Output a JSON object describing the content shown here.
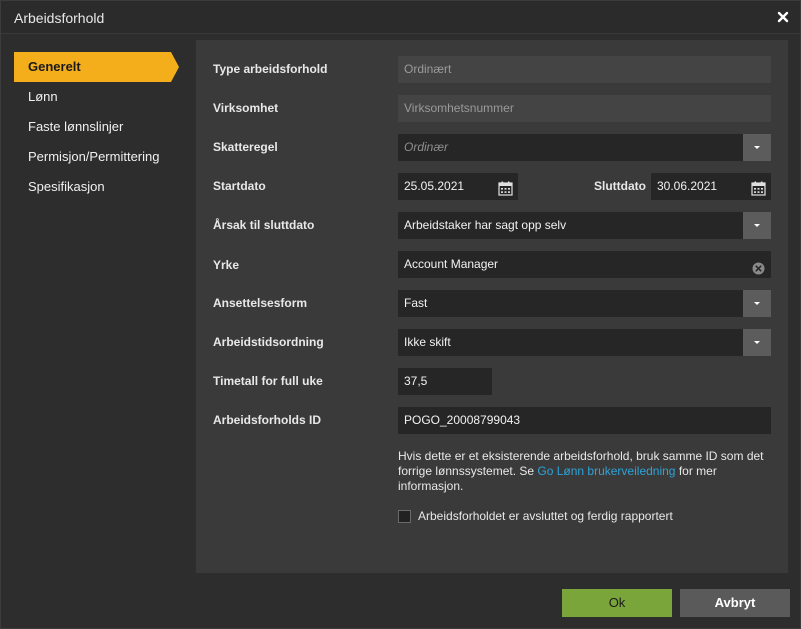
{
  "dialog": {
    "title": "Arbeidsforhold",
    "close_icon": "close-icon"
  },
  "sidebar": {
    "items": [
      {
        "label": "Generelt",
        "active": true
      },
      {
        "label": "Lønn"
      },
      {
        "label": "Faste lønnslinjer"
      },
      {
        "label": "Permisjon/Permittering"
      },
      {
        "label": "Spesifikasjon"
      }
    ]
  },
  "form": {
    "type": {
      "label": "Type arbeidsforhold",
      "value": "Ordinært"
    },
    "virksomhet": {
      "label": "Virksomhet",
      "placeholder": "Virksomhetsnummer"
    },
    "skatteregel": {
      "label": "Skatteregel",
      "placeholder": "Ordinær"
    },
    "startdato": {
      "label": "Startdato",
      "value": "25.05.2021"
    },
    "sluttdato": {
      "label": "Sluttdato",
      "value": "30.06.2021"
    },
    "arsak": {
      "label": "Årsak til sluttdato",
      "value": "Arbeidstaker har sagt opp selv"
    },
    "yrke": {
      "label": "Yrke",
      "value": "Account Manager"
    },
    "ansettelsesform": {
      "label": "Ansettelsesform",
      "value": "Fast"
    },
    "arbeidstid": {
      "label": "Arbeidstidsordning",
      "value": "Ikke skift"
    },
    "timetall": {
      "label": "Timetall for full uke",
      "value": "37,5"
    },
    "id": {
      "label": "Arbeidsforholds ID",
      "value": "POGO_20008799043"
    },
    "note": {
      "before": "Hvis dette er et eksisterende arbeidsforhold, bruk samme ID som det forrige lønnssystemet. Se ",
      "link": "Go Lønn brukerveiledning",
      "after": " for mer informasjon."
    },
    "completed_checkbox": {
      "label": "Arbeidsforholdet er avsluttet og ferdig rapportert",
      "checked": false
    }
  },
  "buttons": {
    "ok": "Ok",
    "cancel": "Avbryt"
  },
  "colors": {
    "accent": "#f4ae1b",
    "ok_button": "#7aa53b",
    "link": "#2ea3d8"
  }
}
